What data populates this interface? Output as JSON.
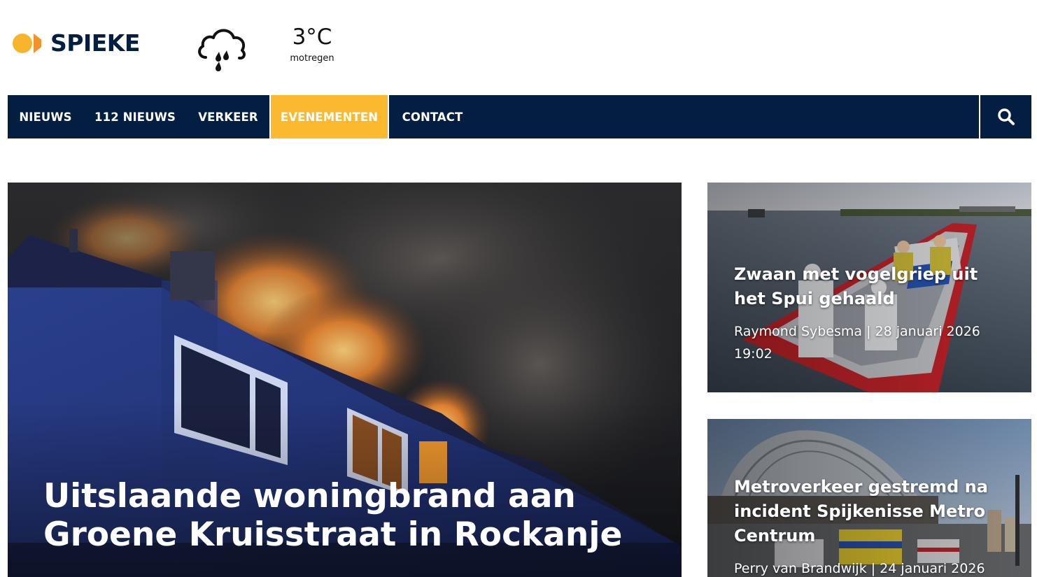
{
  "header": {
    "logo_text": "SPIEKE",
    "weather": {
      "icon": "rain-cloud-icon",
      "temperature": "3°C",
      "description": "motregen"
    }
  },
  "nav": {
    "items": [
      {
        "label": "NIEUWS",
        "active": false
      },
      {
        "label": "112 NIEUWS",
        "active": false
      },
      {
        "label": "VERKEER",
        "active": false
      },
      {
        "label": "EVENEMENTEN",
        "active": true
      },
      {
        "label": "CONTACT",
        "active": false
      }
    ],
    "search_icon": "search-icon"
  },
  "colors": {
    "navy": "#041e42",
    "accent": "#fbb92f",
    "logo_orange": "#f0932b"
  },
  "hero": {
    "title": "Uitslaande woningbrand aan Groene Kruisstraat in Rockanje"
  },
  "side_articles": [
    {
      "title": "Zwaan met vogelgriep uit het Spui gehaald",
      "meta": "Raymond Sybesma | 28 januari 2026 19:02"
    },
    {
      "title": "Metroverkeer gestremd na incident Spijkenisse Metro Centrum",
      "meta": "Perry van Brandwijk | 24 januari 2026"
    }
  ]
}
